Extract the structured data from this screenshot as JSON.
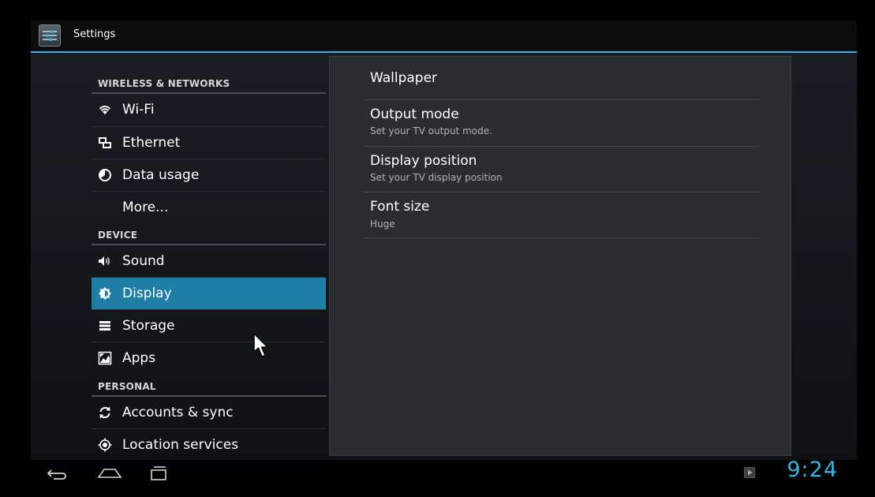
{
  "app": {
    "title": "Settings"
  },
  "left_pane": {
    "categories": [
      "WIRELESS & NETWORKS",
      "DEVICE",
      "PERSONAL"
    ],
    "items": [
      {
        "label": "Wi-Fi",
        "icon": "wifi-icon"
      },
      {
        "label": "Ethernet",
        "icon": "ethernet-icon"
      },
      {
        "label": "Data usage",
        "icon": "data-usage-icon"
      },
      {
        "label": "More...",
        "icon": ""
      },
      {
        "label": "Sound",
        "icon": "sound-icon"
      },
      {
        "label": "Display",
        "icon": "display-icon",
        "selected": true
      },
      {
        "label": "Storage",
        "icon": "storage-icon"
      },
      {
        "label": "Apps",
        "icon": "apps-icon"
      },
      {
        "label": "Accounts & sync",
        "icon": "sync-icon"
      },
      {
        "label": "Location services",
        "icon": "location-icon"
      }
    ]
  },
  "right_pane": {
    "items": [
      {
        "title": "Wallpaper",
        "summary": ""
      },
      {
        "title": "Output mode",
        "summary": "Set your TV output mode."
      },
      {
        "title": "Display position",
        "summary": "Set your TV display position"
      },
      {
        "title": "Font size",
        "summary": "Huge"
      }
    ]
  },
  "status": {
    "time": "9:24"
  },
  "colors": {
    "accent": "#33b5e5",
    "selected": "#1e7ea6"
  }
}
